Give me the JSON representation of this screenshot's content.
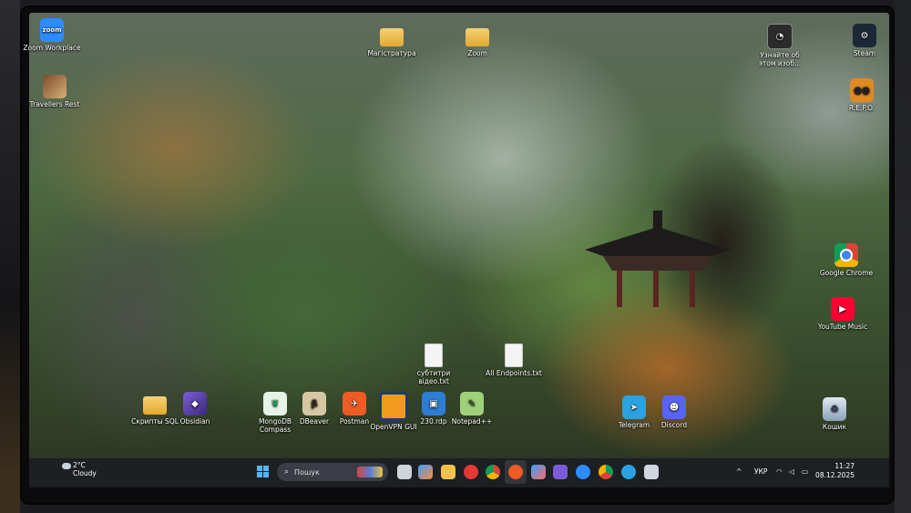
{
  "desktop": {
    "icons": {
      "zoom": {
        "label": "Zoom Workplace",
        "glyph": "zoom"
      },
      "travellers_rest": {
        "label": "Travellers Rest"
      },
      "magistratura": {
        "label": "Магістратура"
      },
      "zoom_folder": {
        "label": "Zoom"
      },
      "about_image": {
        "label": "Узнайте об этом изоб..."
      },
      "steam": {
        "label": "Steam"
      },
      "repo": {
        "label": "R.E.P.O."
      },
      "google_chrome": {
        "label": "Google Chrome"
      },
      "youtube_music": {
        "label": "YouTube Music"
      },
      "subtitles_file": {
        "label": "субтитри відео.txt"
      },
      "all_endpoints_file": {
        "label": "All Endpoints.txt"
      },
      "scripts_sql": {
        "label": "Скрипты SQL"
      },
      "obsidian": {
        "label": "Obsidian"
      },
      "mongodb_compass": {
        "label": "MongoDB Compass"
      },
      "dbeaver": {
        "label": "DBeaver"
      },
      "postman": {
        "label": "Postman"
      },
      "openvpn": {
        "label": "OpenVPN GUI"
      },
      "rdp_230": {
        "label": "230.rdp"
      },
      "notepadpp": {
        "label": "Notepad++"
      },
      "telegram": {
        "label": "Telegram"
      },
      "discord": {
        "label": "Discord"
      },
      "recycle_bin": {
        "label": "Кошик"
      }
    }
  },
  "taskbar": {
    "weather": {
      "temp": "2°C",
      "condition": "Cloudy"
    },
    "search_placeholder": "Пошук",
    "tray": {
      "chevron": "^",
      "language": "УКР"
    },
    "clock": {
      "time": "11:27",
      "date": "08.12.2025"
    }
  },
  "colors": {
    "taskbar_bg": "#1c1e24",
    "accent": "#4fb6ff",
    "zoom_blue": "#2d8cff",
    "chrome_red": "#db4437",
    "youtube_red": "#ff0033",
    "telegram_blue": "#2aa3e0",
    "discord_blurple": "#5865f2",
    "steam_dark": "#1b2838",
    "postman_orange": "#ef5b25"
  }
}
